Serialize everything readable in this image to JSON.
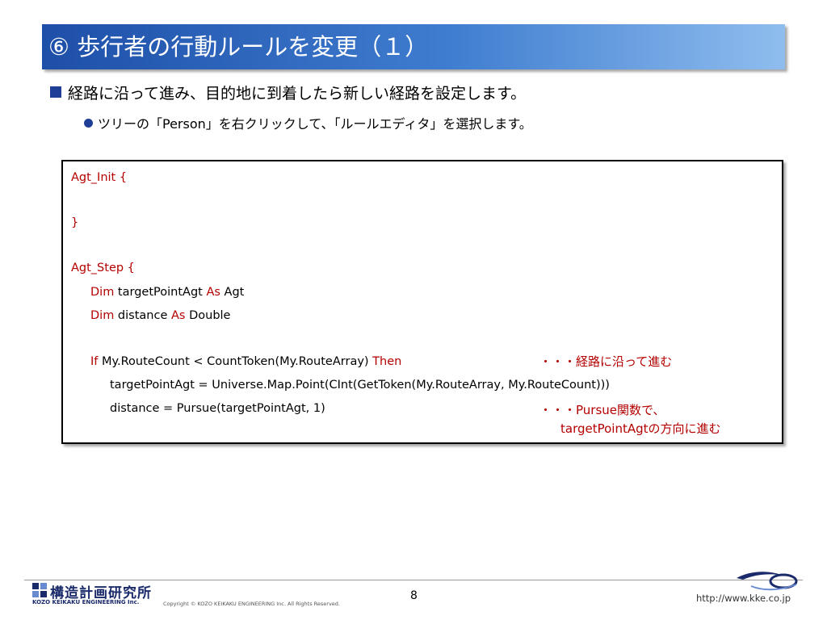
{
  "slide": {
    "title": "⑥ 歩行者の行動ルールを変更（１）",
    "bullet1": "経路に沿って進み、目的地に到着したら新しい経路を設定します。",
    "bullet2": "ツリーの「Person」を右クリックして、「ルールエディタ」を選択します。"
  },
  "code": {
    "l1": "Agt_Init {",
    "l2": "}",
    "l3": "Agt_Step {",
    "l4_kw1": "Dim",
    "l4_txt": " targetPointAgt ",
    "l4_kw2": "As",
    "l4_txt2": " Agt",
    "l5_kw1": "Dim",
    "l5_txt": " distance ",
    "l5_kw2": "As",
    "l5_txt2": " Double",
    "l6_kw1": "If",
    "l6_txt": " My.RouteCount < CountToken(My.RouteArray) ",
    "l6_kw2": "Then",
    "l7": "targetPointAgt = Universe.Map.Point(CInt(GetToken(My.RouteArray, My.RouteCount)))",
    "l8": "distance = Pursue(targetPointAgt, 1)"
  },
  "notes": {
    "n1": "・・・経路に沿って進む",
    "n2a": "・・・Pursue関数で、",
    "n2b": "targetPointAgtの方向に進む"
  },
  "footer": {
    "logo_jp": "構造計画研究所",
    "logo_en": "KOZO KEIKAKU ENGINEERING Inc.",
    "copyright": "Copyright © KOZO KEIKAKU ENGINEERING Inc. All Rights Reserved.",
    "page": "8",
    "url": "http://www.kke.co.jp"
  },
  "colors": {
    "title_bar": "#1e4fa8",
    "bullet": "#1f3f97",
    "keyword": "#b40000"
  }
}
